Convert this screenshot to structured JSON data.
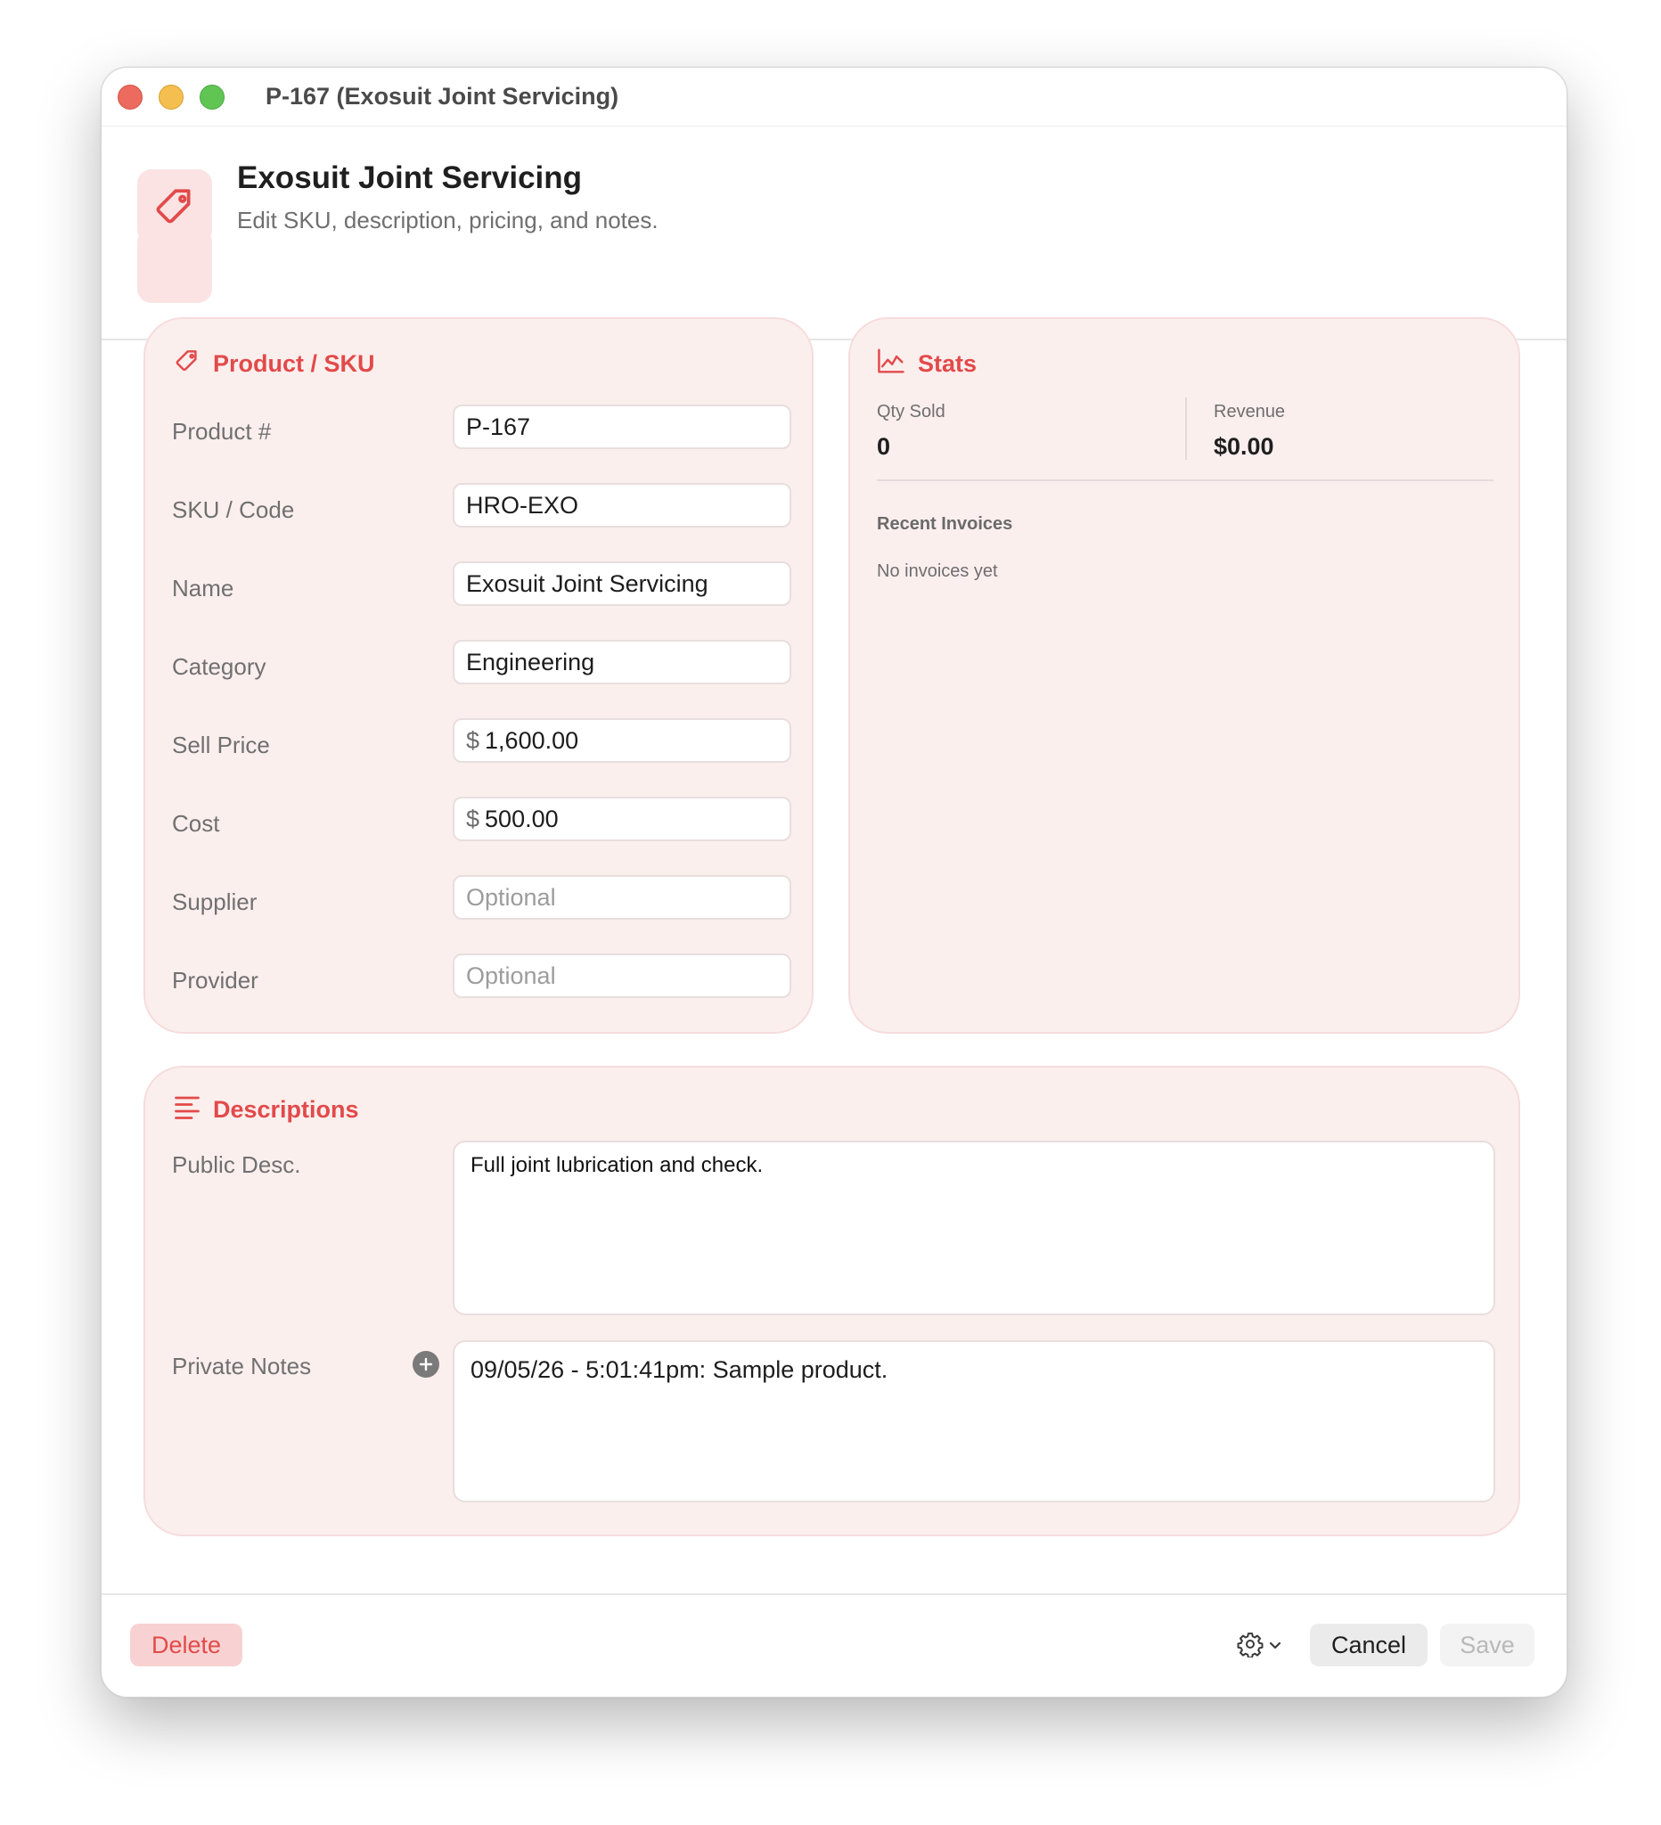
{
  "window": {
    "title": "P-167 (Exosuit Joint Servicing)"
  },
  "header": {
    "icon": "tag-icon",
    "title": "Exosuit Joint Servicing",
    "subtitle": "Edit SKU, description, pricing, and notes."
  },
  "product": {
    "section_title": "Product / SKU",
    "fields": [
      {
        "label": "Product #",
        "value": "P-167"
      },
      {
        "label": "SKU / Code",
        "value": "HRO-EXO"
      },
      {
        "label": "Name",
        "value": "Exosuit Joint Servicing"
      },
      {
        "label": "Category",
        "value": "Engineering"
      },
      {
        "label": "Sell Price",
        "prefix": "$",
        "value": "1,600.00"
      },
      {
        "label": "Cost",
        "prefix": "$",
        "value": "500.00"
      },
      {
        "label": "Supplier",
        "placeholder": "Optional"
      },
      {
        "label": "Provider",
        "placeholder": "Optional"
      }
    ]
  },
  "stats": {
    "section_title": "Stats",
    "qty_label": "Qty Sold",
    "qty_value": "0",
    "revenue_label": "Revenue",
    "revenue_value": "$0.00",
    "recent_title": "Recent Invoices",
    "recent_empty": "No invoices yet"
  },
  "descriptions": {
    "section_title": "Descriptions",
    "public_label": "Public Desc.",
    "public_value": "Full joint lubrication and check.",
    "private_label": "Private Notes",
    "private_value": "09/05/26 - 5:01:41pm: Sample product."
  },
  "footer": {
    "delete_label": "Delete",
    "cancel_label": "Cancel",
    "save_label": "Save"
  },
  "colors": {
    "accent": "#e24a4a",
    "card_bg": "#fbefee",
    "delete_bg": "#f8d2d2"
  }
}
